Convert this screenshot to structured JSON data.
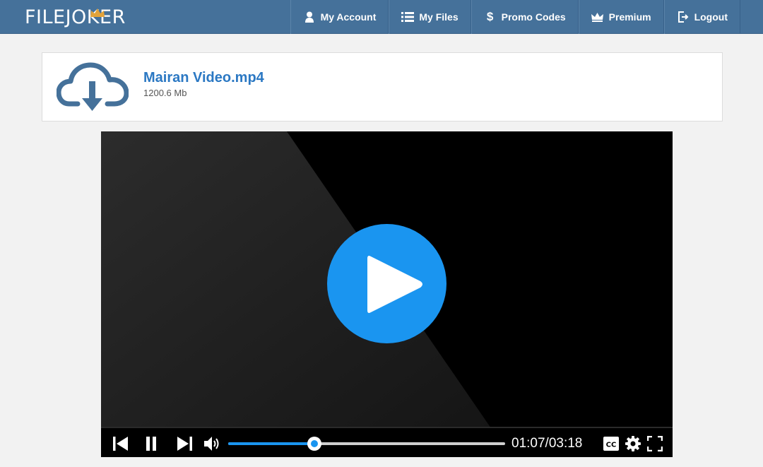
{
  "brand": {
    "name": "FILEJOKER",
    "accent": "#45719a",
    "crown_color": "#e2a33a"
  },
  "nav": {
    "items": [
      {
        "label": "My Account",
        "icon": "user-icon"
      },
      {
        "label": "My Files",
        "icon": "list-icon"
      },
      {
        "label": "Promo Codes",
        "icon": "dollar-icon"
      },
      {
        "label": "Premium",
        "icon": "crown-icon"
      },
      {
        "label": "Logout",
        "icon": "logout-icon"
      }
    ]
  },
  "file": {
    "name": "Mairan Video.mp4",
    "size": "1200.6 Mb",
    "icon": "cloud-download-icon"
  },
  "player": {
    "current_time": "01:07",
    "duration": "03:18",
    "time_display": "01:07/03:18",
    "progress_fraction": 0.311,
    "accent": "#1a95f0",
    "controls": [
      "previous-icon",
      "pause-icon",
      "next-icon",
      "volume-icon",
      "cc-icon",
      "settings-icon",
      "fullscreen-icon"
    ]
  }
}
